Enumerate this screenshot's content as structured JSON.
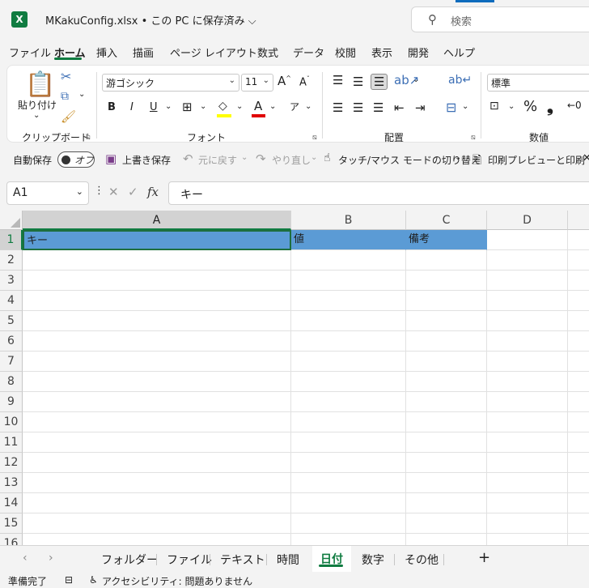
{
  "app": {
    "file_title": "MKakuConfig.xlsx • この PC に保存済み ⌵",
    "search_placeholder": "検索"
  },
  "menu": [
    "ファイル",
    "ホーム",
    "挿入",
    "描画",
    "ページ レイアウト",
    "数式",
    "データ",
    "校閲",
    "表示",
    "開発",
    "ヘルプ"
  ],
  "ribbon": {
    "clipboard": {
      "paste_label": "貼り付け",
      "group_label": "クリップボード"
    },
    "font": {
      "font_name": "游ゴシック",
      "font_size": "11",
      "bold": "B",
      "italic": "I",
      "underline": "U",
      "group_label": "フォント"
    },
    "alignment": {
      "group_label": "配置"
    },
    "number": {
      "format": "標準",
      "percent": "%",
      "comma": "❟",
      "group_label": "数値"
    }
  },
  "qat": {
    "autosave_label": "自動保存",
    "autosave_state": "オフ",
    "overwrite_save": "上書き保存",
    "undo": "元に戻す",
    "redo": "やり直し",
    "touch_mode": "タッチ/マウス モードの切り替え",
    "print_preview": "印刷プレビューと印刷"
  },
  "formula_bar": {
    "cell_ref": "A1",
    "fx": "fx",
    "value": "キー"
  },
  "grid": {
    "columns": [
      "A",
      "B",
      "C",
      "D"
    ],
    "rows": [
      "1",
      "2",
      "3",
      "4",
      "5",
      "6",
      "7",
      "8",
      "9",
      "10",
      "11",
      "12",
      "13",
      "14",
      "15",
      "16"
    ],
    "row1": {
      "A": "キー",
      "B": "値",
      "C": "備考"
    }
  },
  "sheets": {
    "tabs": [
      "フォルダー",
      "ファイル",
      "テキスト",
      "時間",
      "日付",
      "数字",
      "その他"
    ],
    "active": "日付",
    "add": "+"
  },
  "status": {
    "ready": "準備完了",
    "accessibility": "アクセシビリティ: 問題ありません"
  },
  "colors": {
    "accent": "#107c41",
    "header_fill": "#5b9bd5"
  }
}
